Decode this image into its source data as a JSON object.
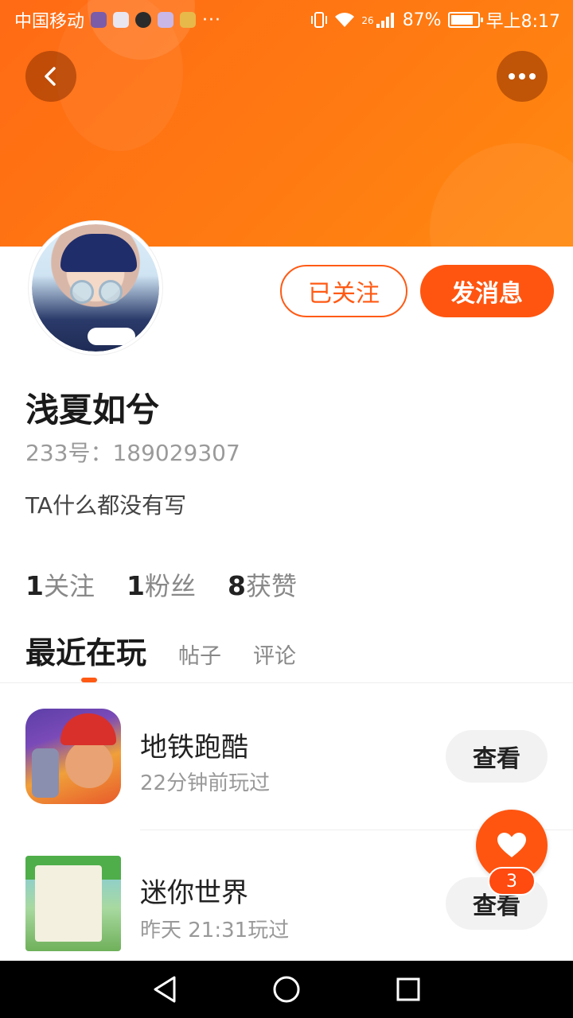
{
  "status_bar": {
    "carrier": "中国移动",
    "more_indicator": "···",
    "network": "26",
    "battery": "87%",
    "battery_level": 0.87,
    "time": "早上8:17",
    "icons": [
      "vibrate-icon",
      "wifi-icon",
      "signal-icon",
      "battery-icon"
    ]
  },
  "header": {
    "back_icon": "chevron-left-icon",
    "more_icon": "more-dots-icon",
    "accent_color": "#ff6a14"
  },
  "profile": {
    "following_button": "已关注",
    "message_button": "发消息",
    "username": "浅夏如兮",
    "user_id": "233号：189029307",
    "bio": "TA什么都没有写",
    "stats": [
      {
        "num": "1",
        "label": "关注"
      },
      {
        "num": "1",
        "label": "粉丝"
      },
      {
        "num": "8",
        "label": "获赞"
      }
    ]
  },
  "tabs": [
    {
      "label": "最近在玩",
      "active": true
    },
    {
      "label": "帖子",
      "active": false
    },
    {
      "label": "评论",
      "active": false
    }
  ],
  "games": [
    {
      "name": "地铁跑酷",
      "time": "22分钟前玩过",
      "button": "查看"
    },
    {
      "name": "迷你世界",
      "time": "昨天 21:31玩过",
      "button": "查看"
    }
  ],
  "like_fab": {
    "icon": "heart-icon",
    "count": "3"
  },
  "nav_bar": {
    "items": [
      "back-icon",
      "home-icon",
      "recents-icon"
    ]
  }
}
